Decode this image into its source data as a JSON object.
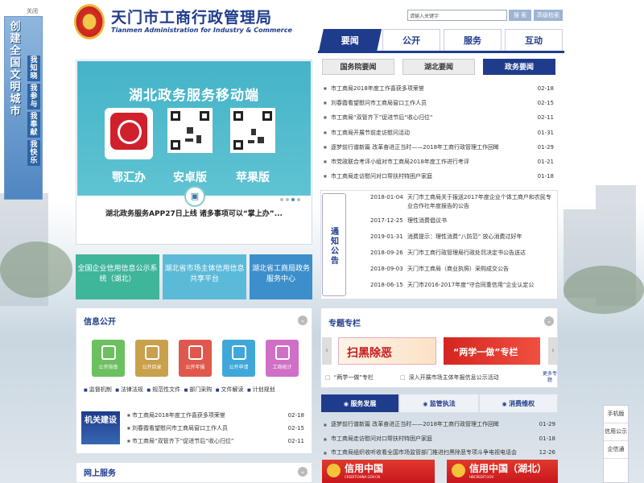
{
  "left_banner": {
    "close_label": "关闭",
    "main_text": "创建全国文明城市",
    "slogans": [
      "我知晓",
      "我参与",
      "我奉献",
      "我快乐"
    ]
  },
  "header": {
    "site_title": "天门市工商行政管理局",
    "site_subtitle": "Tianmen Administration for Industry & Commerce",
    "search_placeholder": "请输入关键字",
    "search_button": "搜 索",
    "advanced_search_button": "高级检索"
  },
  "main_nav": [
    "要闻",
    "公开",
    "服务",
    "互动"
  ],
  "carousel": {
    "heading": "湖北政务服务移动端",
    "apps": [
      "鄂汇办",
      "安卓版",
      "苹果版"
    ],
    "caption": "湖北政务服务APP27日上线 诸多事项可以“掌上办”...",
    "dots": 4,
    "active_dot": 3
  },
  "service_tiles": [
    {
      "label": "全国企业信用信息公示系统（湖北）",
      "color": "#3fb59a"
    },
    {
      "label": "湖北省市场主体信用信息共享平台",
      "color": "#5bbad8"
    },
    {
      "label": "湖北省工商局政务服务中心",
      "color": "#3d8fcb"
    }
  ],
  "news_tabs": [
    "国务院要闻",
    "湖北要闻",
    "政务要闻"
  ],
  "news": [
    {
      "title": "市工商局2018年度工作喜获多项荣誉",
      "date": "02-18"
    },
    {
      "title": "刘春霞看望慰问市工商局窗口工作人员",
      "date": "02-15"
    },
    {
      "title": "市工商局“双管齐下”促进节后“收心归位”",
      "date": "02-11"
    },
    {
      "title": "市工商局开展节前走访慰问活动",
      "date": "01-31"
    },
    {
      "title": "逐梦前行谱新篇 改革奋进正当时——2018年工商行政管理工作回眸",
      "date": "01-29"
    },
    {
      "title": "市党政联合考评小组对市工商局2018年度工作进行考评",
      "date": "01-21"
    },
    {
      "title": "市工商局走访慰问对口帮扶村特困户家庭",
      "date": "01-18"
    }
  ],
  "notices": {
    "label": "通知公告",
    "items": [
      {
        "date": "2018-01-04",
        "title": "天门市工商局关于报送2017年度企业个体工商户和农民专业合作社年度报告的公告"
      },
      {
        "date": "2017-12-25",
        "title": "理性消费倡议书"
      },
      {
        "date": "2019-01-31",
        "title": "消费提示：理性消费“八防范” 放心消费过好年"
      },
      {
        "date": "2018-09-26",
        "title": "天门市工商行政管理局行政处罚决定书公告送达"
      },
      {
        "date": "2018-09-03",
        "title": "天门市工商局（商业执照）采购成交公告"
      },
      {
        "date": "2018-06-15",
        "title": "天门市2016-2017年度“守合同重信用”企业认定公"
      }
    ]
  },
  "info_public": {
    "title": "信息公开",
    "tiles": [
      {
        "label": "公开指南",
        "color": "#6cc05f"
      },
      {
        "label": "公开目录",
        "color": "#c9a14d"
      },
      {
        "label": "公开年报",
        "color": "#e0584d"
      },
      {
        "label": "公开申请",
        "color": "#3fa8d8"
      },
      {
        "label": "工商统计",
        "color": "#d06fc6"
      }
    ],
    "links": [
      "监督机制",
      "法律法规",
      "规范性文件",
      "部门采购",
      "文件解读",
      "计划规划"
    ],
    "party_block": "机关建设",
    "mini_news": [
      {
        "title": "市工商局2018年度工作喜获多项荣誉",
        "date": "02-18"
      },
      {
        "title": "刘春霞看望慰问市工商局窗口工作人员",
        "date": "02-15"
      },
      {
        "title": "市工商局“双管齐下”促进节后“收心归位”",
        "date": "02-11"
      }
    ]
  },
  "online_service": {
    "title": "网上服务"
  },
  "topics": {
    "title": "专题专栏",
    "banner_1": "扫黑除恶",
    "banner_2": "“两学一做”专栏",
    "links": [
      "“两学一做”专栏",
      "深入开展市场主体年报信息公示活动"
    ],
    "more": "更多专题"
  },
  "service_tabs": [
    "服务发展",
    "监管执法",
    "消费维权"
  ],
  "service_news": [
    {
      "title": "逐梦前行谱新篇 改革奋进正当时——2018年工商行政管理工作回眸",
      "date": "01-29"
    },
    {
      "title": "市工商局走访慰问对口帮扶村特困户家庭",
      "date": "01-18"
    },
    {
      "title": "市工商局组织收听收看全国市场监管部门推进扫黑除恶专项斗争电视电话会",
      "date": "12-26"
    }
  ],
  "credit_banners": [
    {
      "title": "信用中国",
      "sub": "CREDITCHINA.GOV.CN"
    },
    {
      "title": "信用中国（湖北）",
      "sub": "HBCREDIT.GOV"
    }
  ],
  "float_bar": [
    "手机版",
    "信用公示",
    "企信通"
  ]
}
